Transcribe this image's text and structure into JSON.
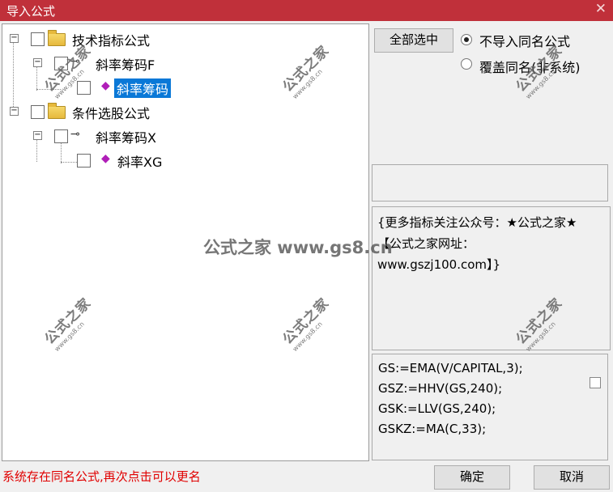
{
  "window": {
    "title": "导入公式",
    "close_glyph": "✕"
  },
  "tree": {
    "nodes": [
      {
        "label": "技术指标公式"
      },
      {
        "label": "斜率筹码F"
      },
      {
        "label": "斜率筹码"
      },
      {
        "label": "条件选股公式"
      },
      {
        "label": "斜率筹码X"
      },
      {
        "label": "斜率XG"
      }
    ],
    "expander": "−"
  },
  "actions": {
    "select_all": "全部选中",
    "ok": "确定",
    "cancel": "取消"
  },
  "import_mode": {
    "options": [
      "不导入同名公式",
      "覆盖同名(非系统)"
    ],
    "selected": 0
  },
  "description": "{更多指标关注公众号：★公式之家★ 【公式之家网址：www.gszj100.com】}",
  "code_lines": [
    "GS:=EMA(V/CAPITAL,3);",
    "GSZ:=HHV(GS,240);",
    "GSK:=LLV(GS,240);",
    "GSKZ:=MA(C,33);"
  ],
  "status_message": "系统存在同名公式,再次点击可以更名",
  "watermark": {
    "brand": "公式之家",
    "url": "www.gs8.cn",
    "center": "公式之家 www.gs8.cn"
  },
  "colors": {
    "title_bar": "#c0303a",
    "selection": "#0a78d7",
    "status_text": "#e00000",
    "gem": "#b01eb8"
  }
}
